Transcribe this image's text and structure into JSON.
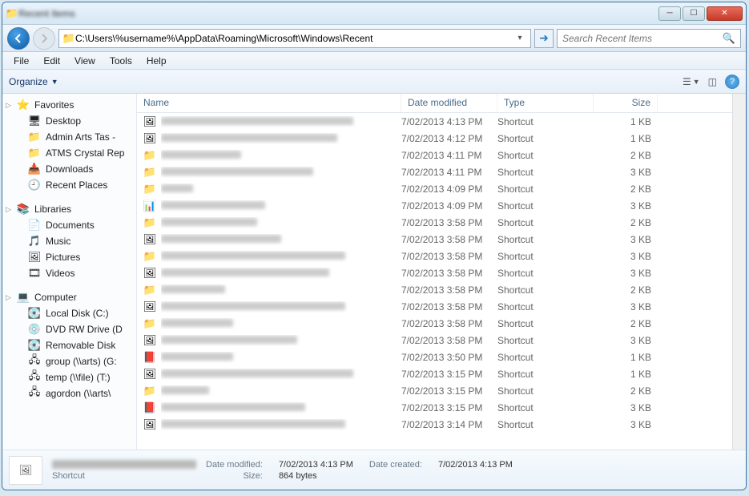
{
  "window": {
    "title": "Recent Items"
  },
  "nav": {
    "path": "C:\\Users\\%username%\\AppData\\Roaming\\Microsoft\\Windows\\Recent",
    "search_placeholder": "Search Recent Items"
  },
  "menubar": [
    "File",
    "Edit",
    "View",
    "Tools",
    "Help"
  ],
  "toolbar": {
    "organize": "Organize"
  },
  "sidebar": {
    "favorites": {
      "label": "Favorites",
      "items": [
        {
          "icon": "desktop",
          "label": "Desktop"
        },
        {
          "icon": "folder",
          "label": "Admin Arts Tas -"
        },
        {
          "icon": "folder",
          "label": "ATMS Crystal Rep"
        },
        {
          "icon": "downloads",
          "label": "Downloads"
        },
        {
          "icon": "recent",
          "label": "Recent Places"
        }
      ]
    },
    "libraries": {
      "label": "Libraries",
      "items": [
        {
          "icon": "doc",
          "label": "Documents"
        },
        {
          "icon": "music",
          "label": "Music"
        },
        {
          "icon": "pictures",
          "label": "Pictures"
        },
        {
          "icon": "videos",
          "label": "Videos"
        }
      ]
    },
    "computer": {
      "label": "Computer",
      "items": [
        {
          "icon": "hdd",
          "label": "Local Disk (C:)"
        },
        {
          "icon": "dvd",
          "label": "DVD RW Drive (D"
        },
        {
          "icon": "hdd",
          "label": "Removable Disk"
        },
        {
          "icon": "net",
          "label": "group (\\\\arts) (G:"
        },
        {
          "icon": "net",
          "label": "temp (\\\\file) (T:)"
        },
        {
          "icon": "net",
          "label": "agordon (\\\\arts\\"
        }
      ]
    }
  },
  "columns": {
    "name": "Name",
    "date": "Date modified",
    "type": "Type",
    "size": "Size"
  },
  "files": [
    {
      "icon": "img",
      "blur": 240,
      "date": "7/02/2013 4:13 PM",
      "type": "Shortcut",
      "size": "1 KB"
    },
    {
      "icon": "img",
      "blur": 220,
      "date": "7/02/2013 4:12 PM",
      "type": "Shortcut",
      "size": "1 KB"
    },
    {
      "icon": "folder",
      "blur": 100,
      "date": "7/02/2013 4:11 PM",
      "type": "Shortcut",
      "size": "2 KB"
    },
    {
      "icon": "folder",
      "blur": 190,
      "date": "7/02/2013 4:11 PM",
      "type": "Shortcut",
      "size": "3 KB"
    },
    {
      "icon": "folder",
      "blur": 40,
      "date": "7/02/2013 4:09 PM",
      "type": "Shortcut",
      "size": "2 KB"
    },
    {
      "icon": "xls",
      "blur": 130,
      "date": "7/02/2013 4:09 PM",
      "type": "Shortcut",
      "size": "3 KB"
    },
    {
      "icon": "folder",
      "blur": 120,
      "date": "7/02/2013 3:58 PM",
      "type": "Shortcut",
      "size": "2 KB"
    },
    {
      "icon": "img",
      "blur": 150,
      "date": "7/02/2013 3:58 PM",
      "type": "Shortcut",
      "size": "3 KB"
    },
    {
      "icon": "folder",
      "blur": 230,
      "date": "7/02/2013 3:58 PM",
      "type": "Shortcut",
      "size": "3 KB"
    },
    {
      "icon": "img",
      "blur": 210,
      "date": "7/02/2013 3:58 PM",
      "type": "Shortcut",
      "size": "3 KB"
    },
    {
      "icon": "folder",
      "blur": 80,
      "date": "7/02/2013 3:58 PM",
      "type": "Shortcut",
      "size": "2 KB"
    },
    {
      "icon": "img",
      "blur": 230,
      "date": "7/02/2013 3:58 PM",
      "type": "Shortcut",
      "size": "3 KB"
    },
    {
      "icon": "folder",
      "blur": 90,
      "date": "7/02/2013 3:58 PM",
      "type": "Shortcut",
      "size": "2 KB"
    },
    {
      "icon": "img",
      "blur": 170,
      "date": "7/02/2013 3:58 PM",
      "type": "Shortcut",
      "size": "3 KB"
    },
    {
      "icon": "ppt",
      "blur": 90,
      "date": "7/02/2013 3:50 PM",
      "type": "Shortcut",
      "size": "1 KB"
    },
    {
      "icon": "img",
      "blur": 240,
      "date": "7/02/2013 3:15 PM",
      "type": "Shortcut",
      "size": "1 KB"
    },
    {
      "icon": "folder",
      "blur": 60,
      "date": "7/02/2013 3:15 PM",
      "type": "Shortcut",
      "size": "2 KB"
    },
    {
      "icon": "pdf",
      "blur": 180,
      "date": "7/02/2013 3:15 PM",
      "type": "Shortcut",
      "size": "3 KB"
    },
    {
      "icon": "img",
      "blur": 230,
      "date": "7/02/2013 3:14 PM",
      "type": "Shortcut",
      "size": "3 KB"
    }
  ],
  "details": {
    "name_blur": 180,
    "type": "Shortcut",
    "date_modified_label": "Date modified:",
    "date_modified": "7/02/2013 4:13 PM",
    "date_created_label": "Date created:",
    "date_created": "7/02/2013 4:13 PM",
    "size_label": "Size:",
    "size": "864 bytes"
  },
  "icons": {
    "desktop": "🖥",
    "folder": "📁",
    "downloads": "📥",
    "recent": "🕘",
    "doc": "📄",
    "music": "🎵",
    "pictures": "🖼",
    "videos": "🎞",
    "hdd": "💽",
    "dvd": "💿",
    "net": "🖧",
    "img": "🖼",
    "xls": "📊",
    "ppt": "📕",
    "pdf": "📕",
    "star": "⭐",
    "lib": "📚",
    "computer": "💻"
  }
}
